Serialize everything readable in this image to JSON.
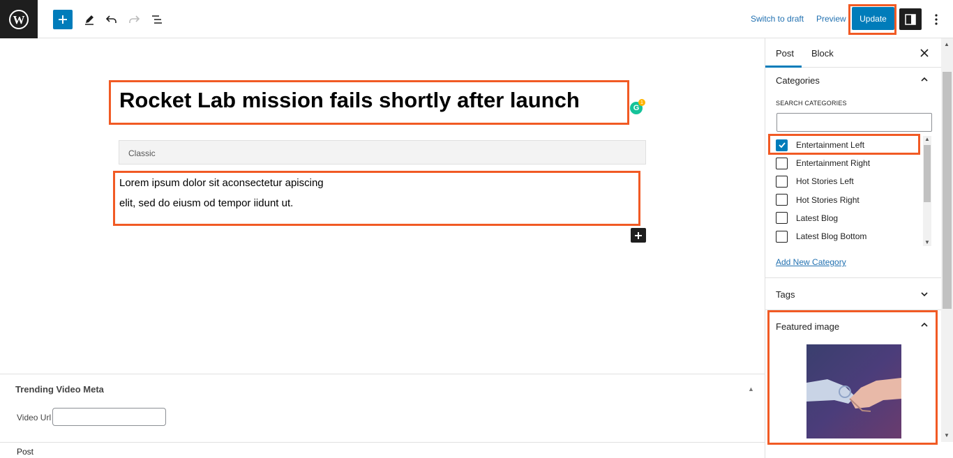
{
  "topbar": {
    "switch_to_draft": "Switch to draft",
    "preview": "Preview",
    "update": "Update"
  },
  "editor": {
    "title": "Rocket Lab mission fails shortly after launch",
    "classic_label": "Classic",
    "paragraph_lines": [
      "Lorem ipsum dolor sit aconsectetur apiscing",
      "elit, sed do eiusm od tempor iidunt ut."
    ],
    "grammarly_count": "1"
  },
  "meta_box": {
    "title": "Trending Video Meta",
    "video_url_label": "Video Url",
    "video_url_value": ""
  },
  "footer": {
    "breadcrumb": "Post"
  },
  "sidebar": {
    "tabs": [
      "Post",
      "Block"
    ],
    "categories": {
      "heading": "Categories",
      "search_label": "SEARCH CATEGORIES",
      "search_value": "",
      "items": [
        {
          "label": "Entertainment Left",
          "checked": true
        },
        {
          "label": "Entertainment Right",
          "checked": false
        },
        {
          "label": "Hot Stories Left",
          "checked": false
        },
        {
          "label": "Hot Stories Right",
          "checked": false
        },
        {
          "label": "Latest Blog",
          "checked": false
        },
        {
          "label": "Latest Blog Bottom",
          "checked": false
        }
      ],
      "add_new": "Add New Category"
    },
    "tags": {
      "heading": "Tags"
    },
    "featured_image": {
      "heading": "Featured image"
    }
  },
  "colors": {
    "accent": "#007cba",
    "highlight": "#f15a24",
    "dark": "#1e1e1e"
  }
}
